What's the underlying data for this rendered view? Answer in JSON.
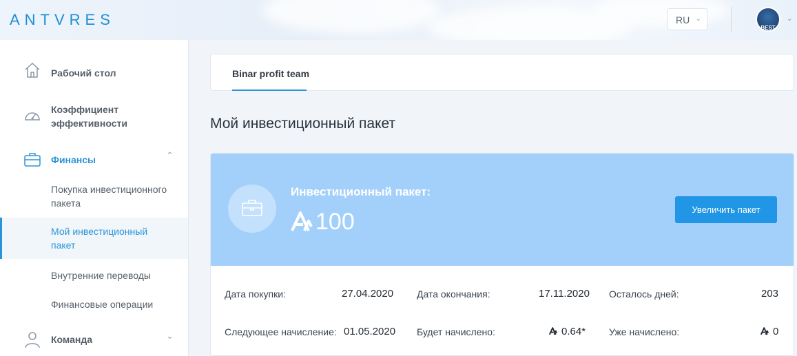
{
  "header": {
    "logo": "ANTVRES",
    "language": "RU",
    "avatar_text": "BEST"
  },
  "sidebar": {
    "items": [
      {
        "label": "Рабочий стол",
        "icon": "home-icon"
      },
      {
        "label": "Коэффициент эффективности",
        "icon": "speedometer-icon"
      },
      {
        "label": "Финансы",
        "icon": "briefcase-icon",
        "expanded": true
      },
      {
        "label": "Команда",
        "icon": "user-icon",
        "expanded": false
      }
    ],
    "finance_sub": [
      {
        "label": "Покупка инвестиционного пакета"
      },
      {
        "label": "Мой инвестиционный пакет",
        "selected": true
      },
      {
        "label": "Внутренние переводы"
      },
      {
        "label": "Финансовые операции"
      }
    ]
  },
  "main": {
    "tabs": [
      {
        "label": "Binar profit team",
        "active": true
      }
    ],
    "title": "Мой инвестиционный пакет",
    "package": {
      "label": "Инвестиционный пакет:",
      "amount": "100",
      "button": "Увеличить пакет"
    },
    "stats": {
      "purchase_date_label": "Дата покупки:",
      "purchase_date": "27.04.2020",
      "end_date_label": "Дата окончания:",
      "end_date": "17.11.2020",
      "days_left_label": "Осталось дней:",
      "days_left": "203",
      "next_accrual_label": "Следующее начисление:",
      "next_accrual": "01.05.2020",
      "will_accrue_label": "Будет начислено:",
      "will_accrue": "0.64*",
      "accrued_label": "Уже начислено:",
      "accrued": "0"
    }
  },
  "colors": {
    "accent": "#2b93d8",
    "banner": "#a3d0fa",
    "button": "#2196e6"
  }
}
